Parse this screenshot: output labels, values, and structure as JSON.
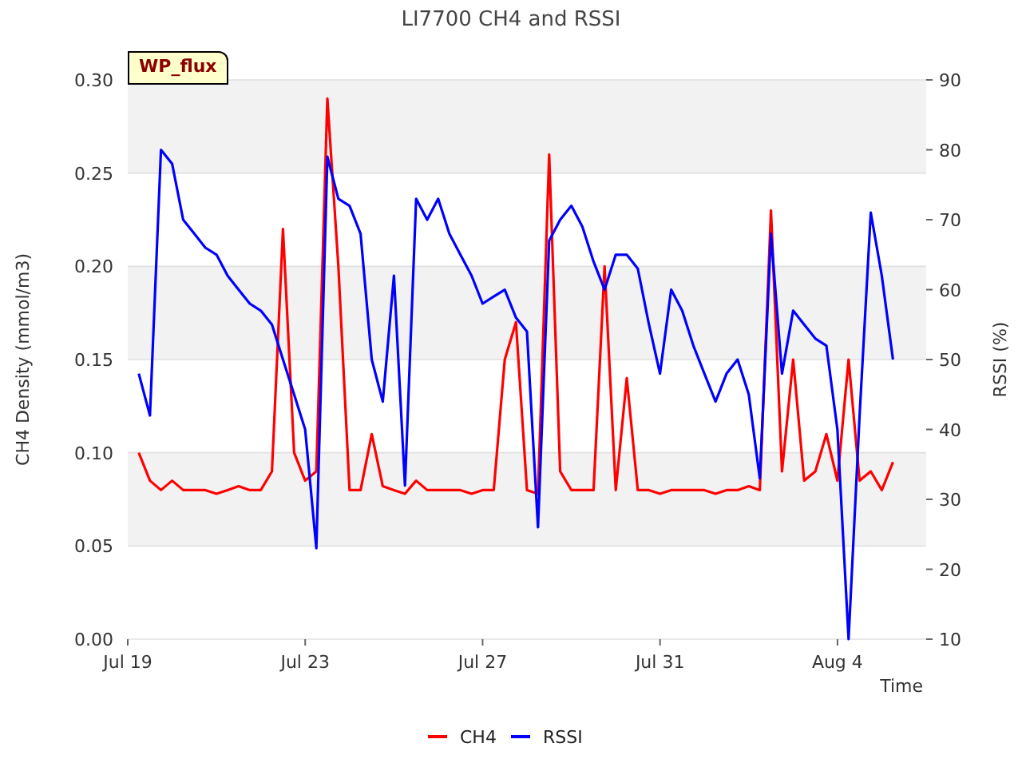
{
  "figure": {
    "title": "LI7700 CH4 and RSSI",
    "tag": "WP_flux",
    "chart_data": {
      "type": "line",
      "xlabel": "Time",
      "ylabel": "CH4 Density (mmol/m3)",
      "ylim": [
        0,
        0.3
      ],
      "grid": true,
      "legend": "bottom",
      "y2label": "RSSI (%)",
      "y2lim": [
        10,
        90
      ],
      "y2ticks": [
        {
          "value": 10,
          "label": "10"
        },
        {
          "value": 20,
          "label": "20"
        },
        {
          "value": 30,
          "label": "30"
        },
        {
          "value": 40,
          "label": "40"
        },
        {
          "value": 50,
          "label": "50"
        },
        {
          "value": 60,
          "label": "60"
        },
        {
          "value": 70,
          "label": "70"
        },
        {
          "value": 80,
          "label": "80"
        },
        {
          "value": 90,
          "label": "90"
        }
      ],
      "yticks": [
        {
          "value": 0,
          "label": "0.00"
        },
        {
          "value": 0.05,
          "label": "0.05"
        },
        {
          "value": 0.1,
          "label": "0.10"
        },
        {
          "value": 0.15,
          "label": "0.15"
        },
        {
          "value": 0.2,
          "label": "0.20"
        },
        {
          "value": 0.25,
          "label": "0.25"
        },
        {
          "value": 0.3,
          "label": "0.30"
        }
      ],
      "categories": [
        "Jul 19",
        null,
        null,
        null,
        null,
        null,
        null,
        null,
        null,
        null,
        null,
        null,
        null,
        null,
        null,
        null,
        "Jul 23",
        null,
        null,
        null,
        null,
        null,
        null,
        null,
        null,
        null,
        null,
        null,
        null,
        null,
        null,
        null,
        "Jul 27",
        null,
        null,
        null,
        null,
        null,
        null,
        null,
        null,
        null,
        null,
        null,
        null,
        null,
        null,
        null,
        "Jul 31",
        null,
        null,
        null,
        null,
        null,
        null,
        null,
        null,
        null,
        null,
        null,
        null,
        null,
        null,
        null,
        "Aug 4",
        null,
        null,
        null,
        null,
        null,
        null,
        null,
        null
      ],
      "series": [
        {
          "name": "CH4",
          "color": "#ff0000",
          "values": [
            null,
            0.1,
            0.085,
            0.08,
            0.085,
            0.08,
            0.08,
            0.08,
            0.078,
            0.08,
            0.082,
            0.08,
            0.08,
            0.09,
            0.22,
            0.1,
            0.085,
            0.09,
            0.29,
            0.2,
            0.08,
            0.08,
            0.11,
            0.082,
            0.08,
            0.078,
            0.085,
            0.08,
            0.08,
            0.08,
            0.08,
            0.078,
            0.08,
            0.08,
            0.15,
            0.17,
            0.08,
            0.078,
            0.26,
            0.09,
            0.08,
            0.08,
            0.08,
            0.2,
            0.08,
            0.14,
            0.08,
            0.08,
            0.078,
            0.08,
            0.08,
            0.08,
            0.08,
            0.078,
            0.08,
            0.08,
            0.082,
            0.08,
            0.23,
            0.09,
            0.15,
            0.085,
            0.09,
            0.11,
            0.085,
            0.15,
            0.085,
            0.09,
            0.08,
            0.095,
            null,
            null,
            null
          ]
        },
        {
          "name": "RSSI",
          "color": "#0000ff",
          "axis": "y2",
          "values": [
            null,
            48,
            42,
            80,
            78,
            70,
            68,
            66,
            65,
            62,
            60,
            58,
            57,
            55,
            50,
            45,
            40,
            23,
            79,
            73,
            72,
            68,
            50,
            44,
            62,
            32,
            73,
            70,
            73,
            68,
            65,
            62,
            58,
            59,
            60,
            56,
            54,
            26,
            67,
            70,
            72,
            69,
            64,
            60,
            65,
            65,
            63,
            55,
            48,
            60,
            57,
            52,
            48,
            44,
            48,
            50,
            45,
            33,
            68,
            48,
            57,
            55,
            53,
            52,
            40,
            10,
            42,
            71,
            62,
            50,
            null,
            null,
            null
          ]
        }
      ]
    }
  }
}
